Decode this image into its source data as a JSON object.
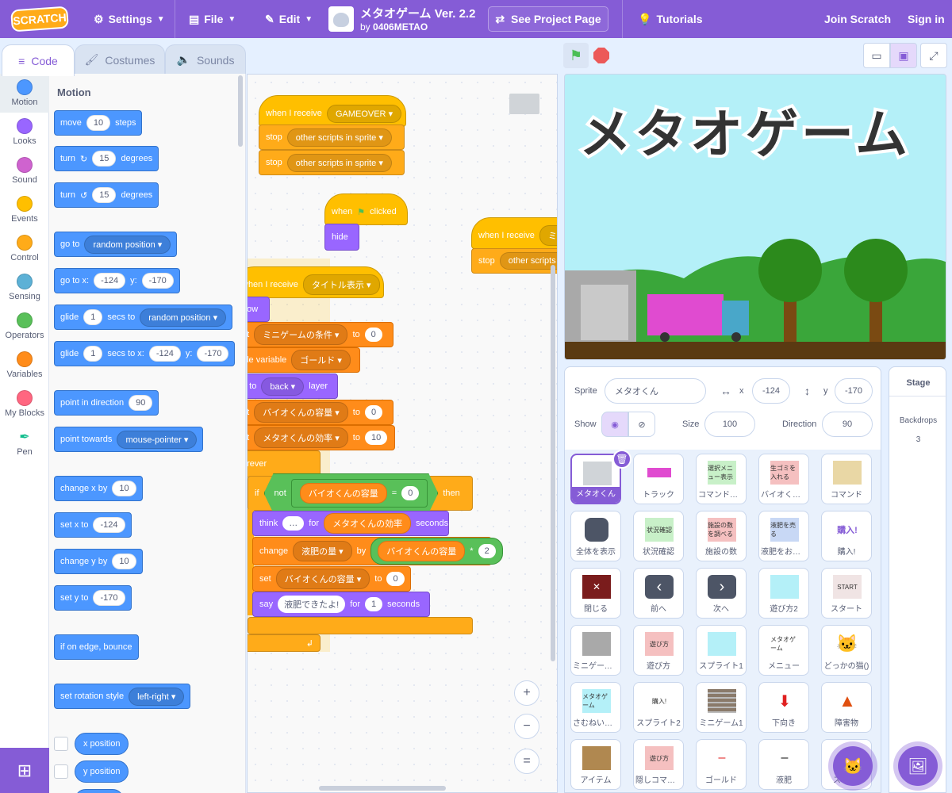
{
  "menubar": {
    "logo": "SCRATCH",
    "settings": "Settings",
    "file": "File",
    "edit": "Edit",
    "project_title": "メタオゲーム Ver. 2.2",
    "by_prefix": "by",
    "author": "0406METAO",
    "see_project": "See Project Page",
    "tutorials": "Tutorials",
    "join": "Join Scratch",
    "signin": "Sign in"
  },
  "tabs": {
    "code": "Code",
    "costumes": "Costumes",
    "sounds": "Sounds"
  },
  "categories": [
    {
      "label": "Motion",
      "color": "#4c97ff"
    },
    {
      "label": "Looks",
      "color": "#9966ff"
    },
    {
      "label": "Sound",
      "color": "#cf63cf"
    },
    {
      "label": "Events",
      "color": "#ffbf00"
    },
    {
      "label": "Control",
      "color": "#ffab19"
    },
    {
      "label": "Sensing",
      "color": "#5cb1d6"
    },
    {
      "label": "Operators",
      "color": "#59c059"
    },
    {
      "label": "Variables",
      "color": "#ff8c1a"
    },
    {
      "label": "My Blocks",
      "color": "#ff6680"
    },
    {
      "label": "Pen",
      "color": ""
    }
  ],
  "palette": {
    "heading": "Motion",
    "move": {
      "a": "move",
      "n": "10",
      "b": "steps"
    },
    "turn_right": {
      "a": "turn",
      "n": "15",
      "b": "degrees"
    },
    "turn_left": {
      "a": "turn",
      "n": "15",
      "b": "degrees"
    },
    "goto": {
      "a": "go to",
      "dd": "random position"
    },
    "gotoxy": {
      "a": "go to x:",
      "x": "-124",
      "y_label": "y:",
      "y": "-170"
    },
    "glide": {
      "a": "glide",
      "n": "1",
      "b": "secs to",
      "dd": "random position"
    },
    "glidexy": {
      "a": "glide",
      "n": "1",
      "b": "secs to x:",
      "x": "-124",
      "y_label": "y:",
      "y": "-170"
    },
    "point_dir": {
      "a": "point in direction",
      "n": "90"
    },
    "point_towards": {
      "a": "point towards",
      "dd": "mouse-pointer"
    },
    "change_x": {
      "a": "change x by",
      "n": "10"
    },
    "set_x": {
      "a": "set x to",
      "n": "-124"
    },
    "change_y": {
      "a": "change y by",
      "n": "10"
    },
    "set_y": {
      "a": "set y to",
      "n": "-170"
    },
    "bounce": "if on edge, bounce",
    "rotation": {
      "a": "set rotation style",
      "dd": "left-right"
    },
    "x_position": "x position",
    "y_position": "y position"
  },
  "code": {
    "s1": {
      "hat": "when I receive",
      "msg": "GAMEOVER",
      "stop1": "stop",
      "stop1_dd": "other scripts in sprite",
      "stop2": "stop",
      "stop2_dd": "other scripts in sprite"
    },
    "s2": {
      "when": "when",
      "clicked": "clicked",
      "hide": "hide"
    },
    "s3": {
      "hat": "when I receive",
      "msg": "ミ",
      "stop": "stop",
      "stop_dd": "other scripts"
    },
    "s4": {
      "hat": "when I receive",
      "msg": "タイトル表示",
      "show": "how",
      "set1": "et",
      "set1_var": "ミニゲームの条件",
      "to1": "to",
      "v1": "0",
      "hide_var": "ide variable",
      "hide_var_dd": "ゴールド",
      "goto": "o to",
      "goto_dd": "back",
      "layer": "layer",
      "set2": "et",
      "set2_var": "バイオくんの容量",
      "to2": "to",
      "v2": "0",
      "set3": "et",
      "set3_var": "メタオくんの効率",
      "to3": "to",
      "v3": "10",
      "forever": "orever",
      "if": "if",
      "not": "not",
      "cmp_var": "バイオくんの容量",
      "eq": "=",
      "cmp_val": "0",
      "then": "then",
      "think": "think",
      "think_val": "…",
      "for": "for",
      "think_var": "メタオくんの効率",
      "seconds": "seconds",
      "change": "change",
      "change_var": "液肥の量",
      "by": "by",
      "mul_var": "バイオくんの容量",
      "mul": "*",
      "mul_val": "2",
      "set4": "set",
      "set4_var": "バイオくんの容量",
      "to4": "to",
      "v4": "0",
      "say": "say",
      "say_val": "液肥できたよ!",
      "say_for": "for",
      "say_n": "1",
      "say_secs": "seconds"
    },
    "zoom_in": "+",
    "zoom_out": "−",
    "zoom_reset": "="
  },
  "stage": {
    "title": "メタオゲーム"
  },
  "sprite_info": {
    "sprite_label": "Sprite",
    "sprite_name": "メタオくん",
    "x_label": "x",
    "x": "-124",
    "y_label": "y",
    "y": "-170",
    "show_label": "Show",
    "size_label": "Size",
    "size": "100",
    "direction_label": "Direction",
    "direction": "90"
  },
  "sprites": [
    {
      "name": "メタオくん",
      "thumb": ""
    },
    {
      "name": "トラック",
      "thumb": ""
    },
    {
      "name": "コマンド表...",
      "thumb": "選択メニュー表示"
    },
    {
      "name": "バイオくん...",
      "thumb": "生ゴミを入れる"
    },
    {
      "name": "コマンド",
      "thumb": ""
    },
    {
      "name": "全体を表示",
      "thumb": ""
    },
    {
      "name": "状況確認",
      "thumb": "状況確認"
    },
    {
      "name": "施設の数",
      "thumb": "施設の数を調べる"
    },
    {
      "name": "液肥をお金...",
      "thumb": "液肥を売る"
    },
    {
      "name": "購入!",
      "thumb": "購入!"
    },
    {
      "name": "閉じる",
      "thumb": "✕"
    },
    {
      "name": "前へ",
      "thumb": "‹"
    },
    {
      "name": "次へ",
      "thumb": "›"
    },
    {
      "name": "遊び方2",
      "thumb": ""
    },
    {
      "name": "スタート",
      "thumb": "START"
    },
    {
      "name": "ミニゲーム...",
      "thumb": ""
    },
    {
      "name": "遊び方",
      "thumb": "遊び方"
    },
    {
      "name": "スプライト1",
      "thumb": ""
    },
    {
      "name": "メニュー",
      "thumb": "メタオゲーム"
    },
    {
      "name": "どっかの猫()",
      "thumb": ""
    },
    {
      "name": "さむねいる...",
      "thumb": "メタオゲーム"
    },
    {
      "name": "スプライト2",
      "thumb": "購入!"
    },
    {
      "name": "ミニゲーム1",
      "thumb": ""
    },
    {
      "name": "下向き",
      "thumb": ""
    },
    {
      "name": "障害物",
      "thumb": ""
    },
    {
      "name": "アイテム",
      "thumb": ""
    },
    {
      "name": "隠しコマン...",
      "thumb": "遊び方"
    },
    {
      "name": "ゴールド",
      "thumb": "‒"
    },
    {
      "name": "液肥",
      "thumb": "‒"
    },
    {
      "name": "スプ...4",
      "thumb": ""
    }
  ],
  "stage_pane": {
    "label": "Stage",
    "backdrops_label": "Backdrops",
    "backdrops": "3"
  }
}
